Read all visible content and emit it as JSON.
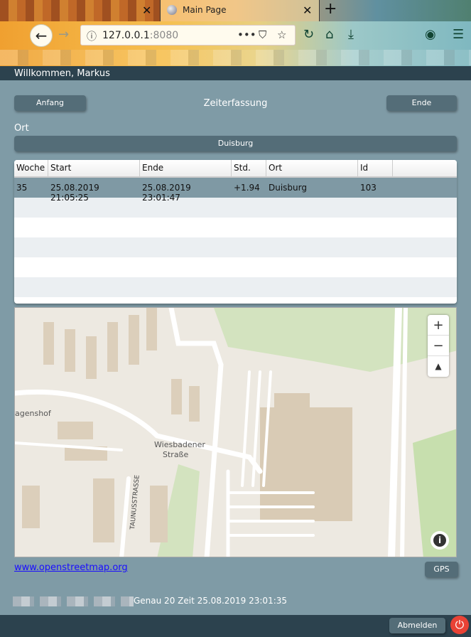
{
  "browser": {
    "tab_active_title": "Main Page",
    "url_host": "127.0.0.1",
    "url_port": ":8080",
    "icons": [
      "back-arrow",
      "forward-arrow",
      "info",
      "more-dots",
      "pocket",
      "star",
      "reload",
      "home",
      "download",
      "account",
      "menu"
    ]
  },
  "header": {
    "welcome": "Willkommen, Markus"
  },
  "toolbar": {
    "start_label": "Anfang",
    "title": "Zeiterfassung",
    "end_label": "Ende"
  },
  "location": {
    "label": "Ort",
    "value": "Duisburg"
  },
  "table": {
    "columns": [
      "Woche",
      "Start",
      "Ende",
      "Std.",
      "Ort",
      "Id"
    ],
    "rows": [
      {
        "woche": "35",
        "start": "25.08.2019 21:05:25",
        "ende": "25.08.2019 23:01:47",
        "std": "+1.94",
        "ort": "Duisburg",
        "id": "103"
      }
    ]
  },
  "map": {
    "labels": {
      "place": "agenshof",
      "street1": "Wiesbadener",
      "street2": "Straße",
      "street3": "TAUNUSSTRASSE"
    },
    "zoom_in": "+",
    "zoom_out": "−",
    "compass": "▲",
    "info": "i"
  },
  "osm_link": "www.openstreetmap.org",
  "gps_label": "GPS",
  "status": "Genau 20 Zeit 25.08.2019 23:01:35",
  "footer": {
    "logout_label": "Abmelden"
  },
  "colors": {
    "background": "#7f9ba6",
    "header": "#2c424e",
    "button": "#546d78",
    "power": "#e94235"
  }
}
